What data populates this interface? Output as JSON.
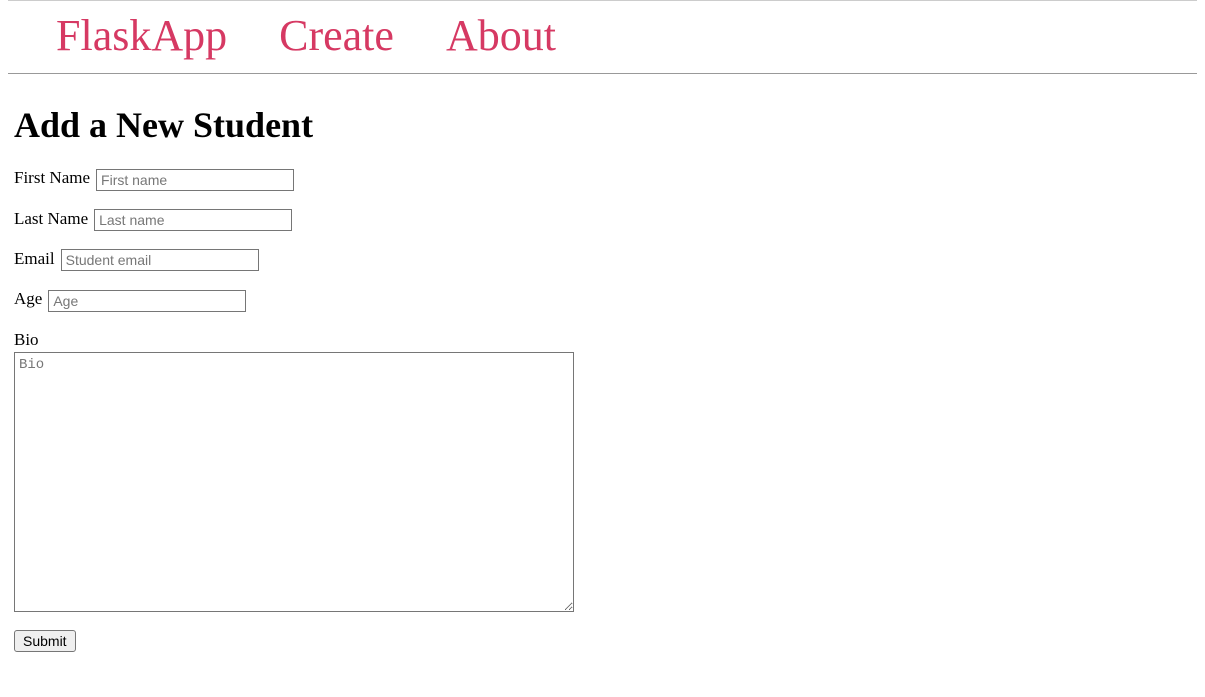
{
  "nav": {
    "brand": "FlaskApp",
    "create": "Create",
    "about": "About"
  },
  "page": {
    "title": "Add a New Student"
  },
  "form": {
    "first_name": {
      "label": "First Name",
      "placeholder": "First name",
      "value": ""
    },
    "last_name": {
      "label": "Last Name",
      "placeholder": "Last name",
      "value": ""
    },
    "email": {
      "label": "Email",
      "placeholder": "Student email",
      "value": ""
    },
    "age": {
      "label": "Age",
      "placeholder": "Age",
      "value": ""
    },
    "bio": {
      "label": "Bio",
      "placeholder": "Bio",
      "value": ""
    },
    "submit_label": "Submit"
  }
}
